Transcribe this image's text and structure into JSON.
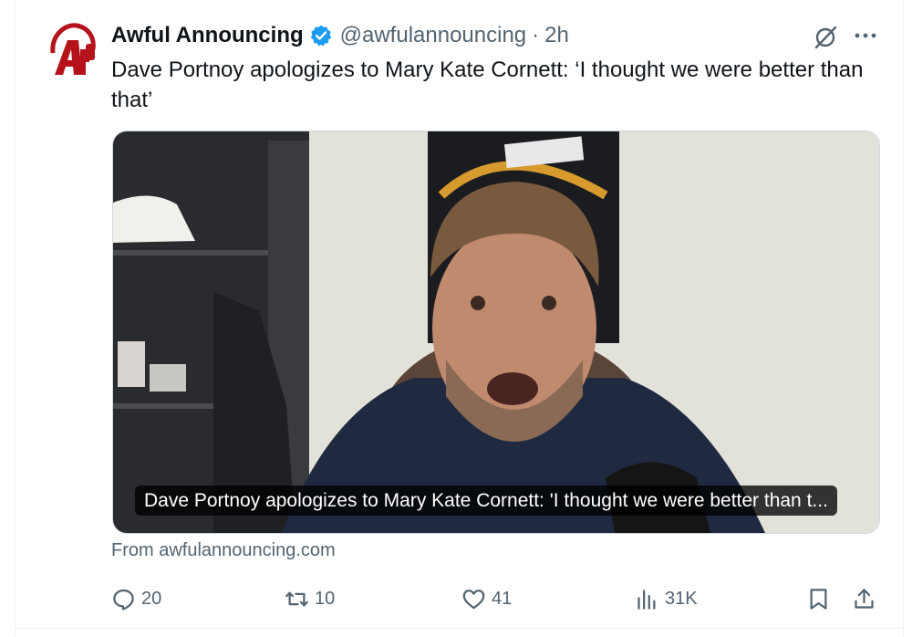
{
  "tweet": {
    "display_name": "Awful Announcing",
    "handle": "@awfulannouncing",
    "separator": "·",
    "time": "2h",
    "text": "Dave Portnoy apologizes to Mary Kate Cornett: ‘I thought we were better than that’",
    "avatar_icon": "awful-announcing-logo",
    "verified_icon": "verified-badge-icon",
    "brand_color": "#b5121b",
    "verified_color": "#1d9bf0"
  },
  "media": {
    "caption": "Dave Portnoy apologizes to Mary Kate Cornett: 'I thought we were better than t...",
    "source": "From awfulannouncing.com"
  },
  "actions": {
    "replies": "20",
    "retweets": "10",
    "likes": "41",
    "views": "31K"
  },
  "icons": {
    "reply": "reply-icon",
    "retweet": "retweet-icon",
    "like": "heart-icon",
    "views": "views-icon",
    "bookmark": "bookmark-icon",
    "share": "share-icon",
    "grok": "grok-icon",
    "more": "more-icon"
  }
}
